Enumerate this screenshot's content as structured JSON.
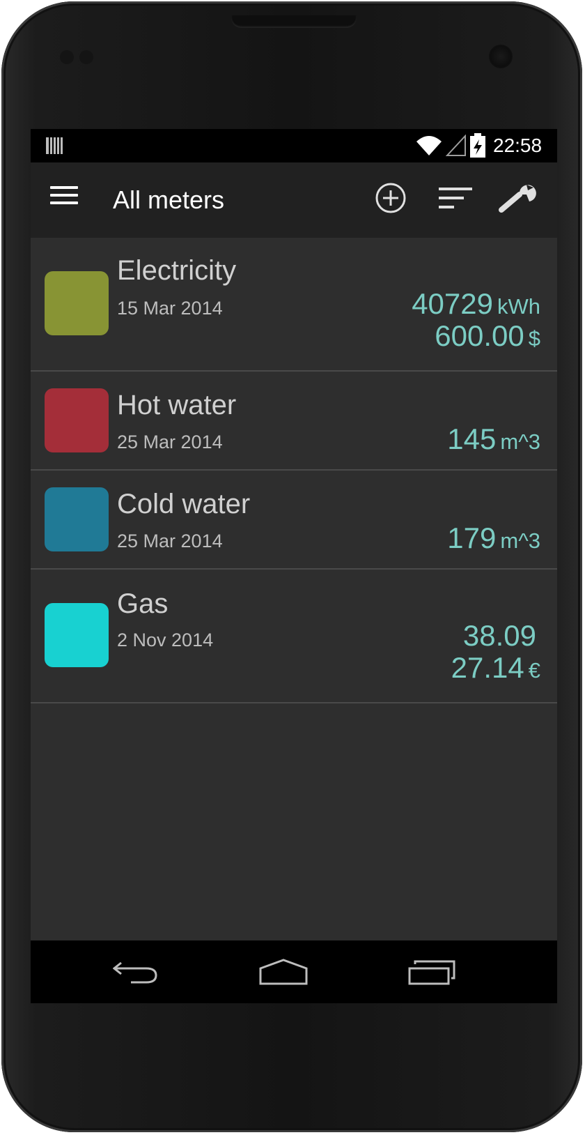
{
  "status_bar": {
    "time": "22:58",
    "icons": [
      "notification-icon",
      "wifi-icon",
      "signal-icon",
      "battery-charging-icon"
    ]
  },
  "action_bar": {
    "title": "All meters",
    "icons": [
      "menu-icon",
      "add-circle-icon",
      "sort-icon",
      "wrench-icon"
    ]
  },
  "meters": [
    {
      "name": "Electricity",
      "date": "15 Mar 2014",
      "color": "#889434",
      "reading": "40729",
      "reading_unit": "kWh",
      "cost": "600.00",
      "cost_unit": "$"
    },
    {
      "name": "Hot water",
      "date": "25 Mar 2014",
      "color": "#a42e39",
      "reading": "145",
      "reading_unit": "m^3"
    },
    {
      "name": "Cold water",
      "date": "25 Mar 2014",
      "color": "#207a96",
      "reading": "179",
      "reading_unit": "m^3"
    },
    {
      "name": "Gas",
      "date": "2 Nov 2014",
      "color": "#18d1d1",
      "reading": "38.09",
      "cost": "27.14",
      "cost_unit": "€"
    }
  ],
  "value_color": "#7ccdc4",
  "nav_bar": {
    "icons": [
      "back-icon",
      "home-icon",
      "recent-apps-icon"
    ]
  }
}
